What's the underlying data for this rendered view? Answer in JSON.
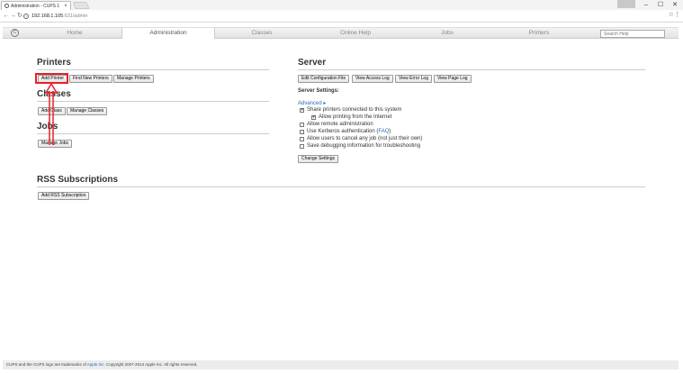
{
  "browser": {
    "tab_title": "Administration - CUPS 1",
    "tab_close": "×",
    "favicon": "cups-favicon",
    "url_host": "192.168.1.105",
    "url_path": ":631/admin",
    "win_minimize": "–",
    "win_maximize": "☐",
    "win_close": "✕"
  },
  "cups_nav": {
    "logo": "C",
    "items": [
      "Home",
      "Administration",
      "Classes",
      "Online Help",
      "Jobs",
      "Printers"
    ],
    "search_placeholder": "Search Help"
  },
  "printers": {
    "heading": "Printers",
    "buttons": [
      "Add Printer",
      "Find New Printers",
      "Manage Printers"
    ]
  },
  "classes": {
    "heading": "Classes",
    "buttons": [
      "Add Class",
      "Manage Classes"
    ]
  },
  "jobs": {
    "heading": "Jobs",
    "buttons": [
      "Manage Jobs"
    ]
  },
  "rss": {
    "heading": "RSS Subscriptions",
    "buttons": [
      "Add RSS Subscription"
    ]
  },
  "server": {
    "heading": "Server",
    "buttons": [
      "Edit Configuration File",
      "View Access Log",
      "View Error Log",
      "View Page Log"
    ],
    "settings_label": "Server Settings:",
    "advanced": "Advanced ▸",
    "options": [
      {
        "label": "Share printers connected to this system",
        "checked": true
      },
      {
        "label": "Allow printing from the Internet",
        "checked": true
      },
      {
        "label": "Allow remote administration",
        "checked": false
      },
      {
        "label": "Use Kerberos authentication (",
        "checked": false,
        "link": "FAQ",
        "suffix": ")"
      },
      {
        "label": "Allow users to cancel any job (not just their own)",
        "checked": false
      },
      {
        "label": "Save debugging information for troubleshooting",
        "checked": false
      }
    ],
    "change_button": "Change Settings"
  },
  "footer": {
    "prefix": "CUPS and the CUPS logo are trademarks of ",
    "link": "Apple Inc.",
    "suffix": " Copyright 2007-2014 Apple Inc. All rights reserved."
  },
  "colors": {
    "annotation": "#e8202a",
    "link": "#3264c8"
  }
}
